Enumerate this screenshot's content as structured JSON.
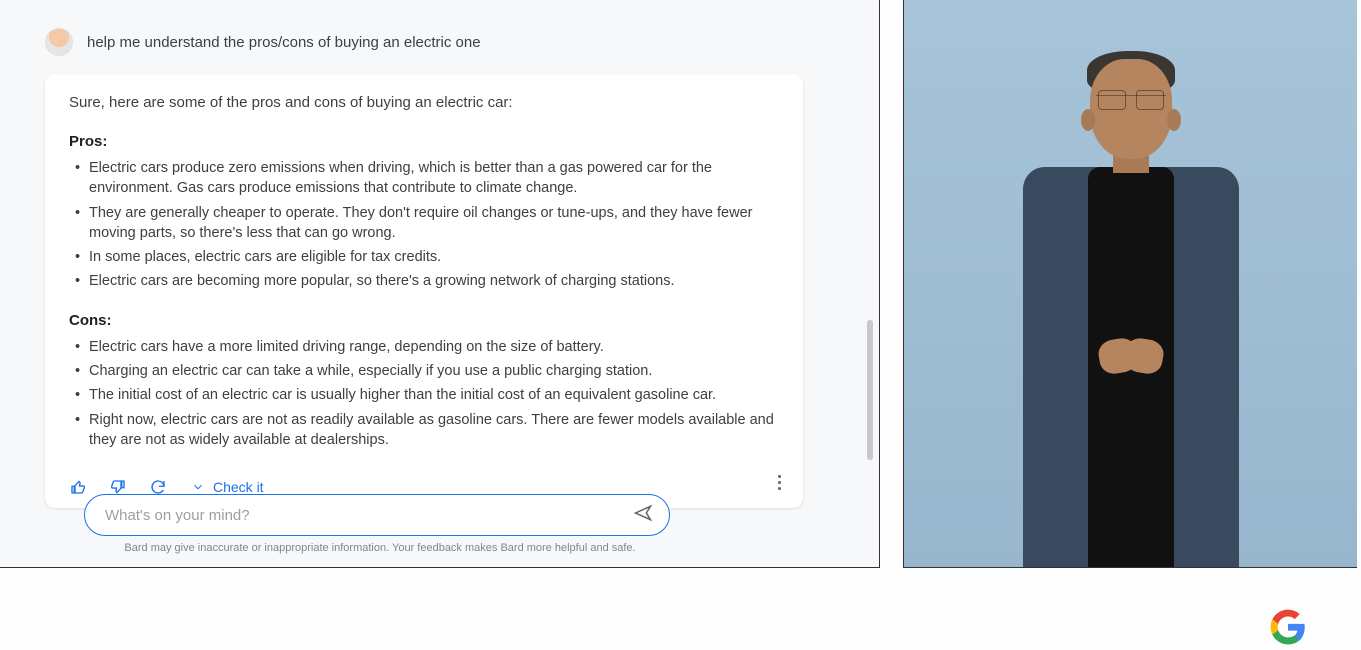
{
  "user_prompt": "help me understand the pros/cons of buying an electric one",
  "response": {
    "intro": "Sure, here are some of the pros and cons of buying an electric car:",
    "pros_heading": "Pros:",
    "pros": [
      "Electric cars produce zero emissions when driving, which is better than a gas powered car for the environment. Gas cars produce emissions that contribute to climate change.",
      "They are generally cheaper to operate. They don't require oil changes or tune-ups, and they have fewer moving parts, so there's less that can go wrong.",
      "In some places, electric cars are eligible for tax credits.",
      "Electric cars are becoming more popular, so there's a growing network of charging stations."
    ],
    "cons_heading": "Cons:",
    "cons": [
      "Electric cars have a more limited driving range, depending on the size of battery.",
      "Charging an electric car can take a while, especially if you use a public charging station.",
      "The initial cost of an electric car is usually higher than the initial cost of an equivalent gasoline car.",
      "Right now, electric cars are not as readily available as gasoline cars. There are fewer models available and they are not as widely available at dealerships."
    ]
  },
  "actions": {
    "check_it": "Check it"
  },
  "input": {
    "placeholder": "What's on your mind?"
  },
  "disclaimer": "Bard may give inaccurate or inappropriate information. Your feedback makes Bard more helpful and safe.",
  "colors": {
    "accent": "#1a73e8"
  }
}
